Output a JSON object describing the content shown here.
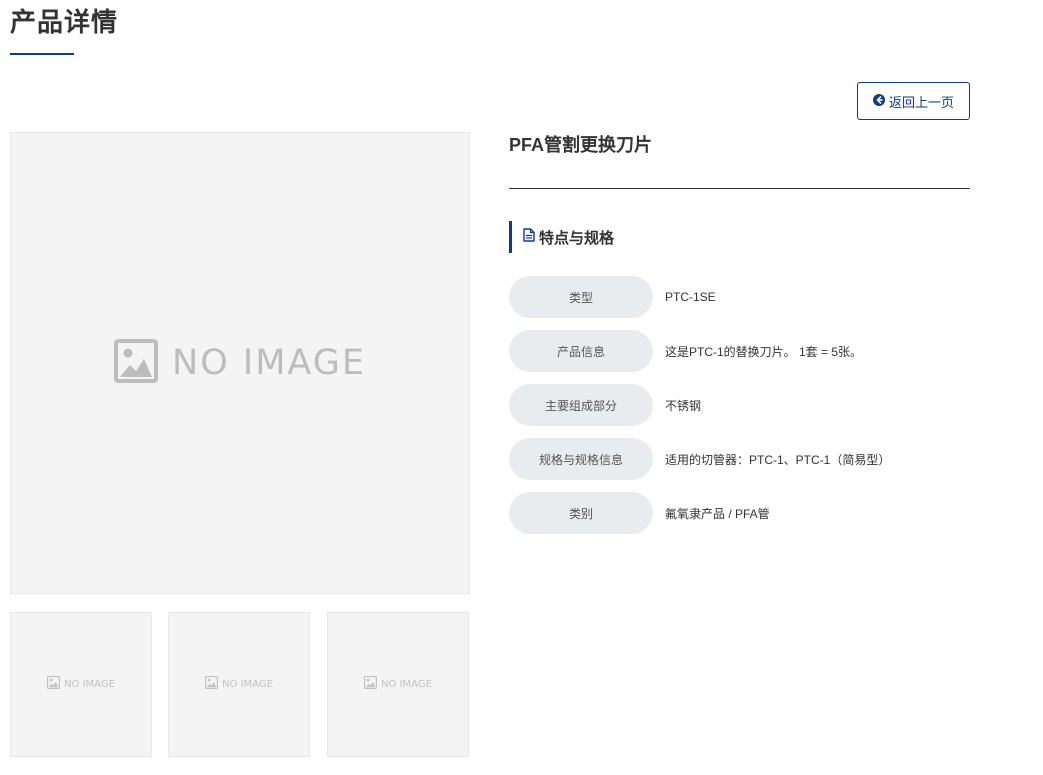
{
  "header": {
    "title": "产品详情"
  },
  "actions": {
    "back_label": "返回上一页",
    "back_icon": "arrow-circle-left-icon"
  },
  "gallery": {
    "main_placeholder": "NO IMAGE",
    "thumbnails": [
      {
        "label": "NO IMAGE"
      },
      {
        "label": "NO IMAGE"
      },
      {
        "label": "NO IMAGE"
      }
    ]
  },
  "product": {
    "name": "PFA管割更换刀片"
  },
  "specs": {
    "section_title": "特点与规格",
    "section_icon": "document-icon",
    "rows": [
      {
        "label": "类型",
        "value": "PTC-1SE"
      },
      {
        "label": "产品信息",
        "value": "这是PTC-1的替换刀片。 1套 = 5张。"
      },
      {
        "label": "主要组成部分",
        "value": "不锈钢"
      },
      {
        "label": "规格与规格信息",
        "value": "适用的切管器：PTC-1、PTC-1（简易型）"
      },
      {
        "label": "类别",
        "value": "氟氧隶产品 / PFA管"
      }
    ]
  },
  "colors": {
    "accent": "#0d3b85",
    "label_bg": "#e9ecef",
    "placeholder_bg": "#f4f4f4"
  }
}
